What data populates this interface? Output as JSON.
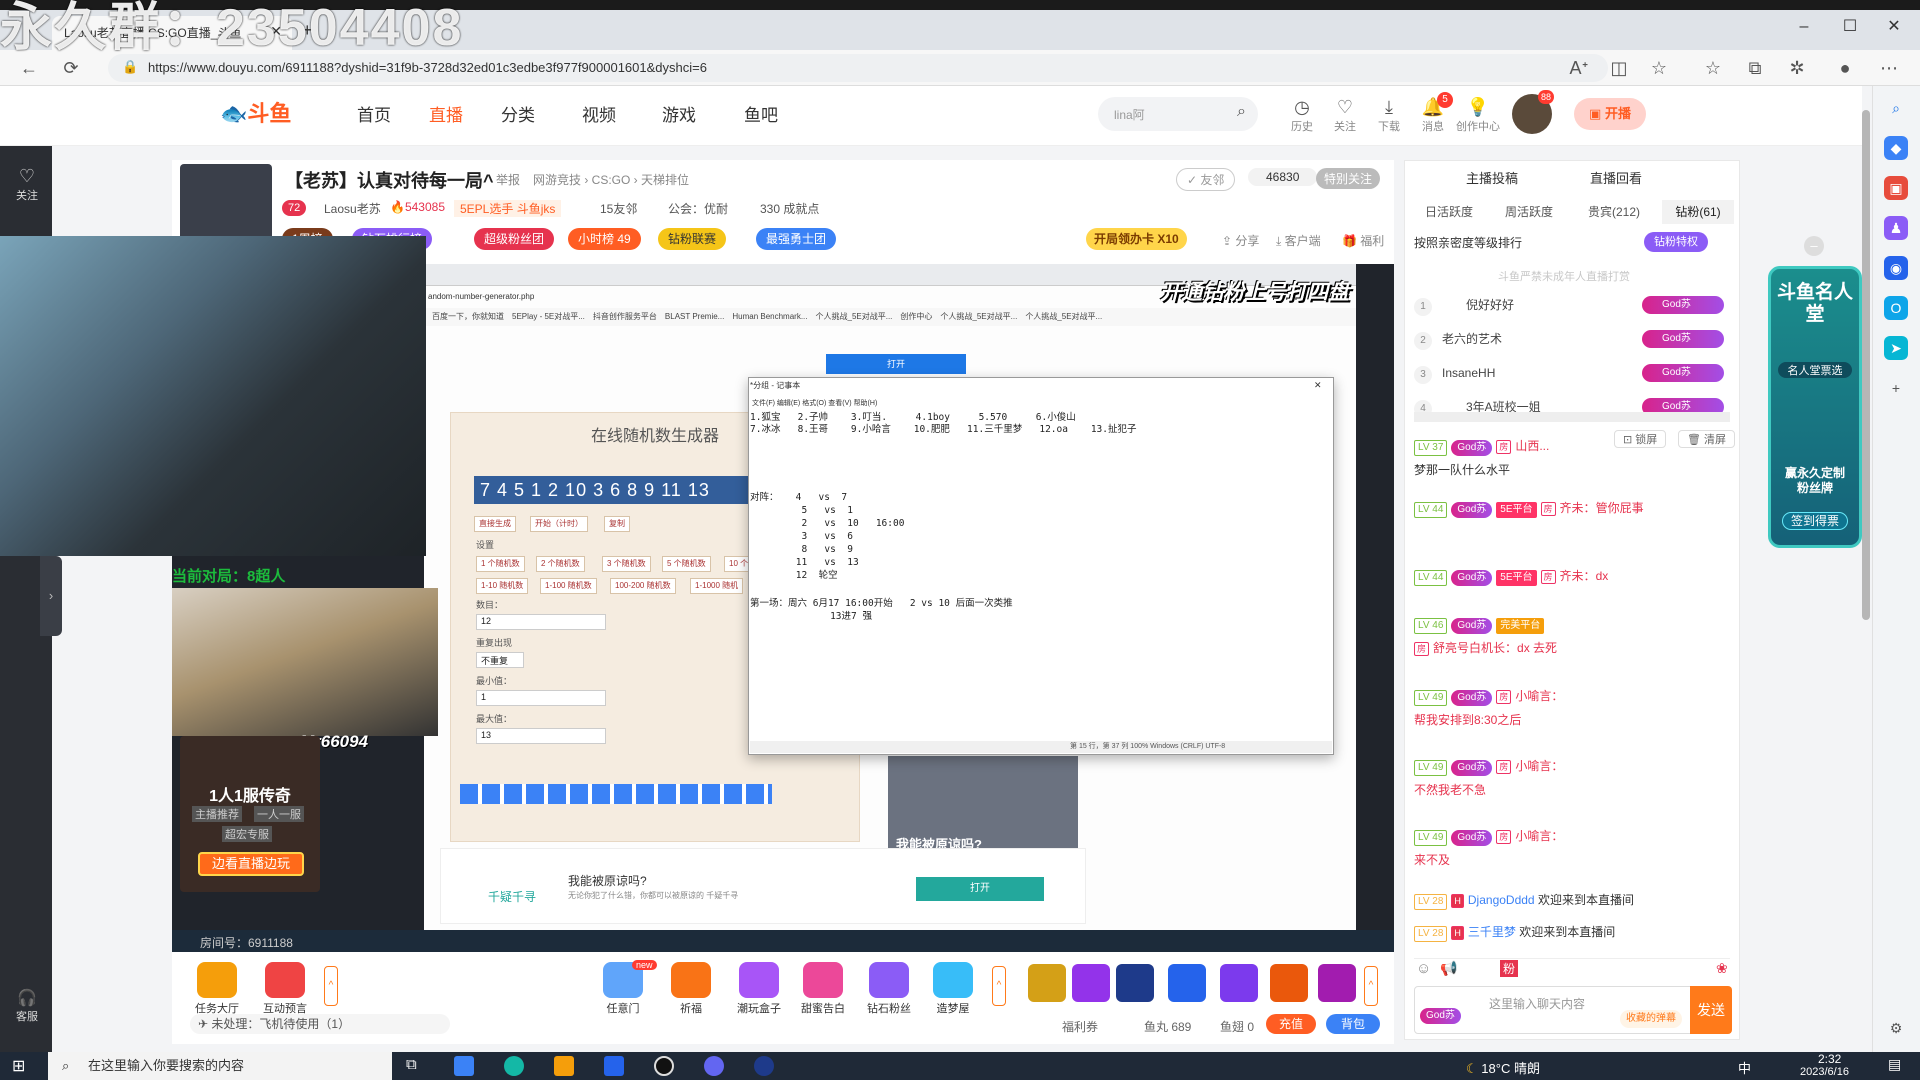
{
  "browser": {
    "tab_title": "Laosu老苏直播 CS:GO直播_斗鱼",
    "url": "https://www.douyu.com/6911188?dyshid=31f9b-3728d32ed01c3edbe3f977f900001601&dyshci=6",
    "watermark": "永久群：23504408"
  },
  "header": {
    "logo": "斗鱼",
    "nav": [
      "首页",
      "直播",
      "分类",
      "视频",
      "游戏",
      "鱼吧"
    ],
    "search_placeholder": "lina阿",
    "icons": [
      {
        "label": "历史",
        "icon": "history-icon"
      },
      {
        "label": "关注",
        "icon": "heart-icon"
      },
      {
        "label": "下载",
        "icon": "download-icon"
      },
      {
        "label": "消息",
        "icon": "bell-icon",
        "badge": "5"
      },
      {
        "label": "创作中心",
        "icon": "bulb-icon"
      }
    ],
    "avatar_badge": "88",
    "open_live": "开播"
  },
  "leftrail": {
    "follow": "关注",
    "service": "客服"
  },
  "room": {
    "title": "【老苏】认真对待每一局^",
    "report": "举报",
    "category_path": "网游竞技 › CS:GO › 天梯排位",
    "follow_btn": "✓ 友邻",
    "followers": "46830",
    "special_follow": "特别关注",
    "level": "72",
    "streamer": "Laosu老苏",
    "hot": "543085",
    "tag": "5EPL选手 斗鱼jks",
    "friends": "15友邻",
    "guild": "公会：优耐",
    "achievements": "330 成就点",
    "pills": [
      "1周榜",
      "钻石排行榜",
      "超级粉丝团",
      "小时榜 49",
      "钻粉联赛",
      "最强勇士团"
    ],
    "card": "开局领办卡 X10",
    "share": "分享",
    "client": "客户端",
    "welfare": "福利"
  },
  "video": {
    "overlay": "开通钻粉上号打四盘",
    "cam_label": "当前对局：8超人",
    "overlay_code": "Mr66094",
    "game_title": "1人1服传奇",
    "game_tags": [
      "主播推荐",
      "一人一服",
      "超宏专服"
    ],
    "game_btn": "边看直播边玩",
    "room_id": "房间号：6911188"
  },
  "screen": {
    "url": "andom-number-generator.php",
    "bookmarks": [
      "百度一下，你就知道",
      "5EPlay - 5E对战平...",
      "抖音创作服务平台",
      "BLAST Premie...",
      "Human Benchmark...",
      "个人挑战_5E对战平...",
      "创作中心",
      "个人挑战_5E对战平...",
      "个人挑战_5E对战平..."
    ],
    "rng_title": "在线随机数生成器",
    "rng_digits": "7 4 5 1 2 10 3 6 8 9 11 13",
    "rng_controls": [
      "直接生成",
      "开始（计时）",
      "复制"
    ],
    "rng_settings": "设置",
    "count_btns": [
      "1 个随机数",
      "2 个随机数",
      "3 个随机数",
      "5 个随机数",
      "10 个"
    ],
    "range_btns": [
      "1-10 随机数",
      "1-100 随机数",
      "100-200 随机数",
      "1-1000 随机"
    ],
    "count_label": "数目：",
    "count_value": "12",
    "repeat_label": "重复出现",
    "repeat_value": "不重复",
    "min_label": "最小值：",
    "min_value": "1",
    "max_label": "最大值：",
    "max_value": "13",
    "ad_text": "我能被原谅吗?",
    "ad_sub": "无论你犯了什么错，你都可以被原谅的 千疑千寻",
    "ad_btn": "打开",
    "ad_brand": "千疑千寻",
    "top_btn": "打开",
    "page_text": "我能被原谅吗?"
  },
  "notepad": {
    "title": "*分组 - 记事本",
    "menu": [
      "文件(F)",
      "编辑(E)",
      "格式(O)",
      "查看(V)",
      "帮助(H)"
    ],
    "lines": [
      "1.狐宝   2.子帅    3.叮当.     4.1boy     5.570     6.小俊山",
      "7.冰冰   8.王哥    9.小哈言    10.肥肥   11.三千里梦   12.oa    13.扯犯子",
      "",
      "",
      "",
      "对阵：   4   vs  7",
      "         5   vs  1",
      "         2   vs  10   16:00",
      "         3   vs  6",
      "         8   vs  9",
      "        11   vs  13",
      "        12  轮空",
      "",
      "第一场：周六 6月17 16:00开始   2 vs 10 后面一次类推",
      "              13进7 强"
    ],
    "status": "第 15 行，第 37 列   100%   Windows (CRLF)   UTF-8"
  },
  "toolbar": {
    "left": [
      "任务大厅",
      "互动预言"
    ],
    "mid": [
      "任意门",
      "祈福",
      "潮玩盒子",
      "甜蜜告白",
      "钻石粉丝",
      "造梦屋"
    ],
    "pending": "未处理：飞机待使用（1）",
    "coupon": "福利券",
    "fish_ball": "鱼丸 689",
    "fish_fin": "鱼翅 0",
    "recharge": "充值",
    "backpack": "背包",
    "new_badge": "new"
  },
  "chat": {
    "contribute": "主播投稿",
    "replay": "直播回看",
    "tabs": [
      "日活跃度",
      "周活跃度",
      "贵宾(212)",
      "钻粉(61)"
    ],
    "rank_hint": "按照亲密度等级排行",
    "rank_privilege": "钻粉特权",
    "notice": "斗鱼严禁未成年人直播打赏",
    "ranks": [
      {
        "n": "1",
        "name": "倪好好好",
        "badge": "God苏"
      },
      {
        "n": "2",
        "name": "老六的艺术",
        "badge": "God苏"
      },
      {
        "n": "3",
        "name": "InsaneHH",
        "badge": "God苏"
      },
      {
        "n": "4",
        "name": "3年A班校一姐",
        "badge": "God苏"
      }
    ],
    "lock": "锁屏",
    "clear": "清屏",
    "messages": [
      {
        "lv": "LV 37",
        "badge": "God苏",
        "tag": "",
        "name": "山西...",
        "text": "梦那一队什么水平"
      },
      {
        "lv": "LV 44",
        "badge": "God苏",
        "tag": "5E平台",
        "name": "齐未：",
        "text": "管你屁事"
      },
      {
        "lv": "LV 44",
        "badge": "God苏",
        "tag": "5E平台",
        "name": "齐未：",
        "text": "dx"
      },
      {
        "lv": "LV 46",
        "badge": "God苏",
        "tag": "完美平台",
        "name": "舒亮号白机长：",
        "text": "dx 去死"
      },
      {
        "lv": "LV 49",
        "badge": "God苏",
        "tag": "",
        "name": "小喻言：",
        "text": "帮我安排到8:30之后"
      },
      {
        "lv": "LV 49",
        "badge": "God苏",
        "tag": "",
        "name": "小喻言：",
        "text": "不然我老不急"
      },
      {
        "lv": "LV 49",
        "badge": "God苏",
        "tag": "",
        "name": "小喻言：",
        "text": "来不及"
      },
      {
        "lv": "LV 28",
        "badge": "",
        "tag": "",
        "name": "DjangoDddd",
        "text": "欢迎来到本直播间"
      },
      {
        "lv": "LV 28",
        "badge": "",
        "tag": "",
        "name": "三千里梦",
        "text": "欢迎来到本直播间"
      }
    ],
    "input_placeholder": "这里输入聊天内容",
    "input_badge": "God苏",
    "danmu_btn": "收藏的弹幕",
    "send": "发送"
  },
  "fame": {
    "title": "斗鱼名人堂",
    "sub": "名人堂票选",
    "btn1": "赢永久定制粉丝牌",
    "btn2": "签到得票"
  },
  "taskbar": {
    "search": "在这里输入你要搜索的内容",
    "weather": "18°C 晴朗",
    "ime": "中",
    "time": "2:32",
    "date": "2023/6/16"
  }
}
